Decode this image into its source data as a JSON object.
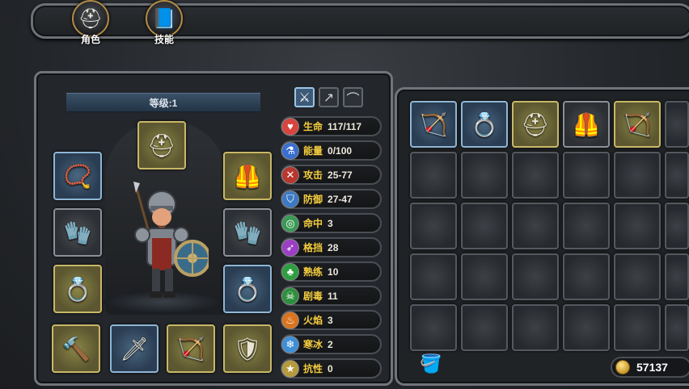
{
  "tabs": [
    {
      "label": "角色",
      "icon": "helmet-icon"
    },
    {
      "label": "技能",
      "icon": "spellbook-icon"
    }
  ],
  "character": {
    "level_label": "等级:1"
  },
  "weapon_filters": [
    "sword-icon",
    "spear-icon",
    "bow-icon"
  ],
  "equipment_slots": [
    {
      "name": "helmet",
      "icon": "helmet-icon",
      "rarity": "gold"
    },
    {
      "name": "amulet",
      "icon": "amulet-icon",
      "rarity": "blue"
    },
    {
      "name": "armor",
      "icon": "armor-icon",
      "rarity": "gold"
    },
    {
      "name": "gloves-left",
      "icon": "gauntlet-icon",
      "rarity": "gray"
    },
    {
      "name": "gloves-right",
      "icon": "gauntlet-icon",
      "rarity": "gray"
    },
    {
      "name": "ring-left",
      "icon": "ring-icon",
      "rarity": "gold"
    },
    {
      "name": "ring-right",
      "icon": "ring-icon",
      "rarity": "blue"
    },
    {
      "name": "mace",
      "icon": "mace-icon",
      "rarity": "gold"
    },
    {
      "name": "spear",
      "icon": "spear-icon",
      "rarity": "blue"
    },
    {
      "name": "crossbow",
      "icon": "crossbow-icon",
      "rarity": "gold"
    },
    {
      "name": "shield",
      "icon": "shield-icon",
      "rarity": "gold"
    }
  ],
  "stats": [
    {
      "label": "生命",
      "value": "117/117",
      "icon": "heart-icon",
      "color": "#d9443f"
    },
    {
      "label": "能量",
      "value": "0/100",
      "icon": "potion-icon",
      "color": "#3a6fd0"
    },
    {
      "label": "攻击",
      "value": "25-77",
      "icon": "crossed-swords-icon",
      "color": "#b8372f"
    },
    {
      "label": "防御",
      "value": "27-47",
      "icon": "shield-icon",
      "color": "#3c79c2"
    },
    {
      "label": "命中",
      "value": "3",
      "icon": "target-icon",
      "color": "#3a9a55"
    },
    {
      "label": "格挡",
      "value": "28",
      "icon": "parry-icon",
      "color": "#9b3fc4"
    },
    {
      "label": "熟练",
      "value": "10",
      "icon": "clover-icon",
      "color": "#2f9e40"
    },
    {
      "label": "剧毒",
      "value": "11",
      "icon": "skull-icon",
      "color": "#2e8f3d"
    },
    {
      "label": "火焰",
      "value": "3",
      "icon": "flame-icon",
      "color": "#d8741f"
    },
    {
      "label": "寒冰",
      "value": "2",
      "icon": "snowflake-icon",
      "color": "#3f8fd6"
    },
    {
      "label": "抗性",
      "value": "0",
      "icon": "star-icon",
      "color": "#b59a3d"
    }
  ],
  "inventory": [
    {
      "icon": "crossbow-icon",
      "rarity": "blue"
    },
    {
      "icon": "ring-icon",
      "rarity": "blue"
    },
    {
      "icon": "helmet-icon",
      "rarity": "gold"
    },
    {
      "icon": "armor-icon",
      "rarity": "gray"
    },
    {
      "icon": "bow-icon",
      "rarity": "gold"
    }
  ],
  "gold": "57137"
}
